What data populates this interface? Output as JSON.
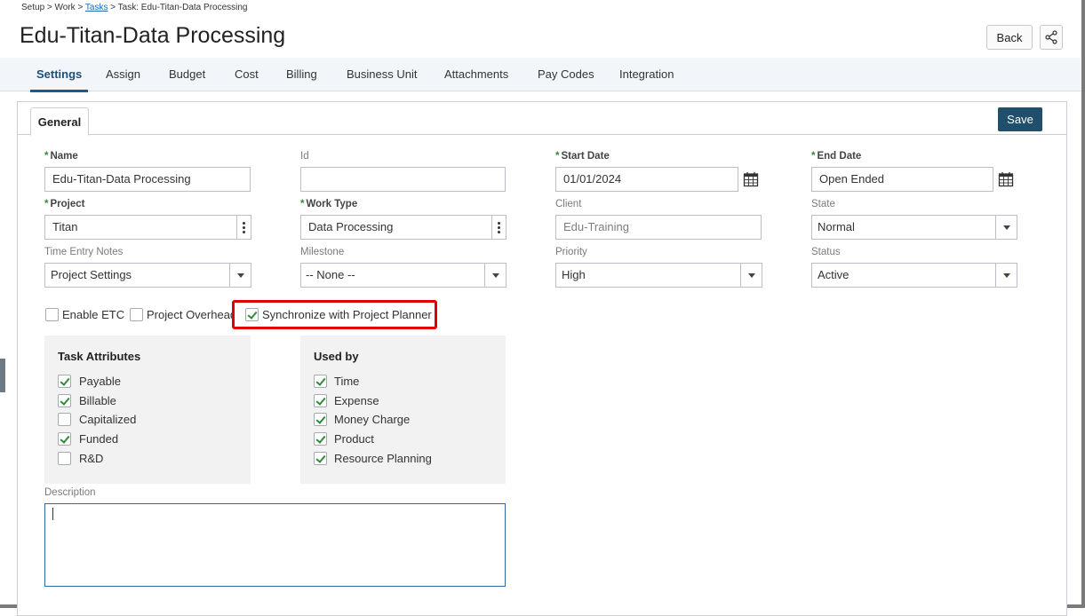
{
  "breadcrumb": {
    "part1": "Setup > Work > ",
    "link": "Tasks",
    "part2": " > Task: Edu-Titan-Data Processing"
  },
  "title": "Edu-Titan-Data Processing",
  "header": {
    "back_label": "Back",
    "share_icon": "share-icon"
  },
  "tabs": [
    "Settings",
    "Assign",
    "Budget",
    "Cost",
    "Billing",
    "Business Unit",
    "Attachments",
    "Pay Codes",
    "Integration"
  ],
  "active_tab": "Settings",
  "panel": {
    "tab_label": "General",
    "save_label": "Save"
  },
  "fields": {
    "name": {
      "label": "Name",
      "value": "Edu-Titan-Data Processing"
    },
    "id": {
      "label": "Id",
      "value": ""
    },
    "start_date": {
      "label": "Start Date",
      "value": "01/01/2024"
    },
    "end_date": {
      "label": "End Date",
      "value": "Open Ended"
    },
    "project": {
      "label": "Project",
      "value": "Titan"
    },
    "work_type": {
      "label": "Work Type",
      "value": "Data Processing"
    },
    "client": {
      "label": "Client",
      "value": "Edu-Training"
    },
    "state": {
      "label": "State",
      "value": "Normal"
    },
    "time_entry_notes": {
      "label": "Time Entry Notes",
      "value": "Project Settings"
    },
    "milestone": {
      "label": "Milestone",
      "value": "-- None --"
    },
    "priority": {
      "label": "Priority",
      "value": "High"
    },
    "status": {
      "label": "Status",
      "value": "Active"
    }
  },
  "options": [
    {
      "label": "Enable ETC",
      "checked": false
    },
    {
      "label": "Project Overhead",
      "checked": false
    },
    {
      "label": "Synchronize with Project Planner",
      "checked": true
    }
  ],
  "task_attributes": {
    "title": "Task Attributes",
    "items": [
      {
        "label": "Payable",
        "checked": true
      },
      {
        "label": "Billable",
        "checked": true
      },
      {
        "label": "Capitalized",
        "checked": false
      },
      {
        "label": "Funded",
        "checked": true
      },
      {
        "label": "R&D",
        "checked": false
      }
    ]
  },
  "used_by": {
    "title": "Used by",
    "items": [
      {
        "label": "Time",
        "checked": true
      },
      {
        "label": "Expense",
        "checked": true
      },
      {
        "label": "Money Charge",
        "checked": true
      },
      {
        "label": "Product",
        "checked": true
      },
      {
        "label": "Resource Planning",
        "checked": true
      }
    ]
  },
  "description": {
    "label": "Description",
    "value": ""
  },
  "colors": {
    "accent": "#1d5a8a",
    "save_bg": "#1f4f6a",
    "required_star": "#2e8b3a",
    "highlight": "#e00000"
  }
}
